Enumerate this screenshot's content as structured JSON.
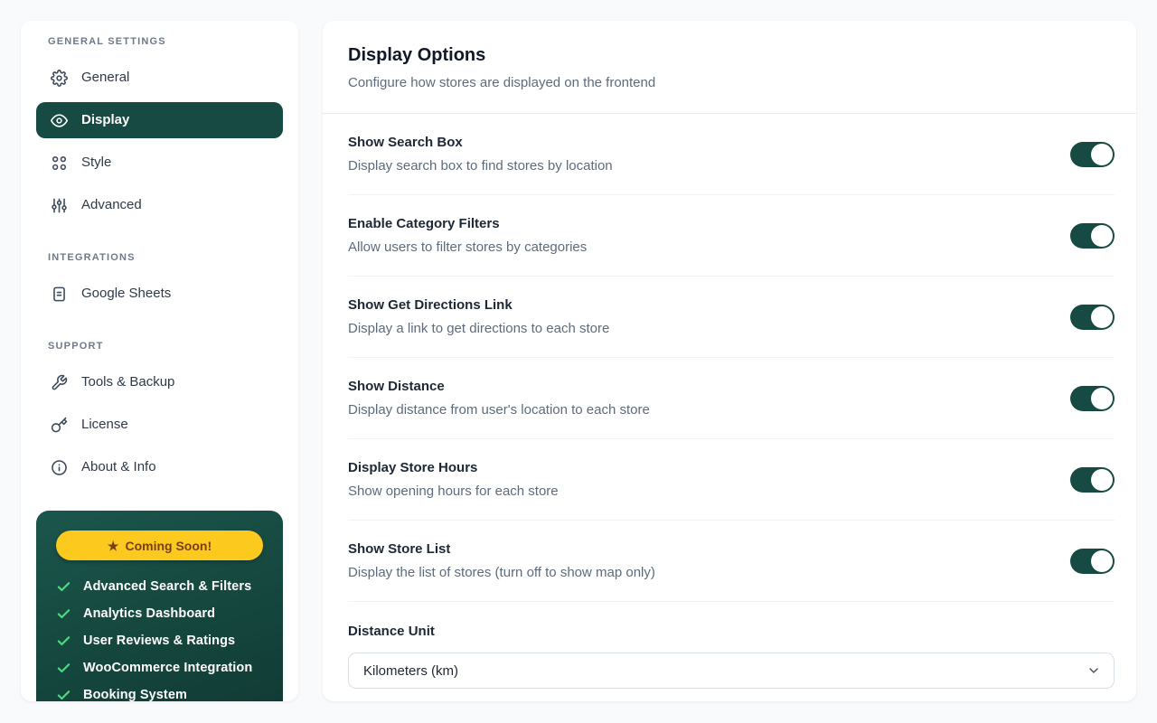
{
  "colors": {
    "accent": "#164a42",
    "page_bg": "#f8fafc",
    "promo_gradient_start": "#1b564c",
    "promo_gradient_end": "#103a33",
    "badge_bg": "#fcca1e",
    "badge_text": "#7b3e10",
    "check_green": "#4ade80"
  },
  "sidebar": {
    "sections": [
      {
        "heading": "GENERAL SETTINGS",
        "items": [
          {
            "icon": "gear",
            "label": "General",
            "active": false
          },
          {
            "icon": "eye",
            "label": "Display",
            "active": true
          },
          {
            "icon": "grid",
            "label": "Style",
            "active": false
          },
          {
            "icon": "sliders",
            "label": "Advanced",
            "active": false
          }
        ]
      },
      {
        "heading": "INTEGRATIONS",
        "items": [
          {
            "icon": "document",
            "label": "Google Sheets",
            "active": false
          }
        ]
      },
      {
        "heading": "SUPPORT",
        "items": [
          {
            "icon": "tools",
            "label": "Tools & Backup",
            "active": false
          },
          {
            "icon": "key",
            "label": "License",
            "active": false
          },
          {
            "icon": "info",
            "label": "About & Info",
            "active": false
          }
        ]
      }
    ],
    "promo": {
      "badge_star": "★",
      "badge_label": "Coming Soon!",
      "features": [
        "Advanced Search & Filters",
        "Analytics Dashboard",
        "User Reviews & Ratings",
        "WooCommerce Integration",
        "Booking System"
      ]
    }
  },
  "main": {
    "title": "Display Options",
    "subtitle": "Configure how stores are displayed on the frontend",
    "settings": [
      {
        "title": "Show Search Box",
        "description": "Display search box to find stores by location",
        "enabled": true
      },
      {
        "title": "Enable Category Filters",
        "description": "Allow users to filter stores by categories",
        "enabled": true
      },
      {
        "title": "Show Get Directions Link",
        "description": "Display a link to get directions to each store",
        "enabled": true
      },
      {
        "title": "Show Distance",
        "description": "Display distance from user's location to each store",
        "enabled": true
      },
      {
        "title": "Display Store Hours",
        "description": "Show opening hours for each store",
        "enabled": true
      },
      {
        "title": "Show Store List",
        "description": "Display the list of stores (turn off to show map only)",
        "enabled": true
      }
    ],
    "distance_unit": {
      "label": "Distance Unit",
      "value": "Kilometers (km)"
    }
  }
}
